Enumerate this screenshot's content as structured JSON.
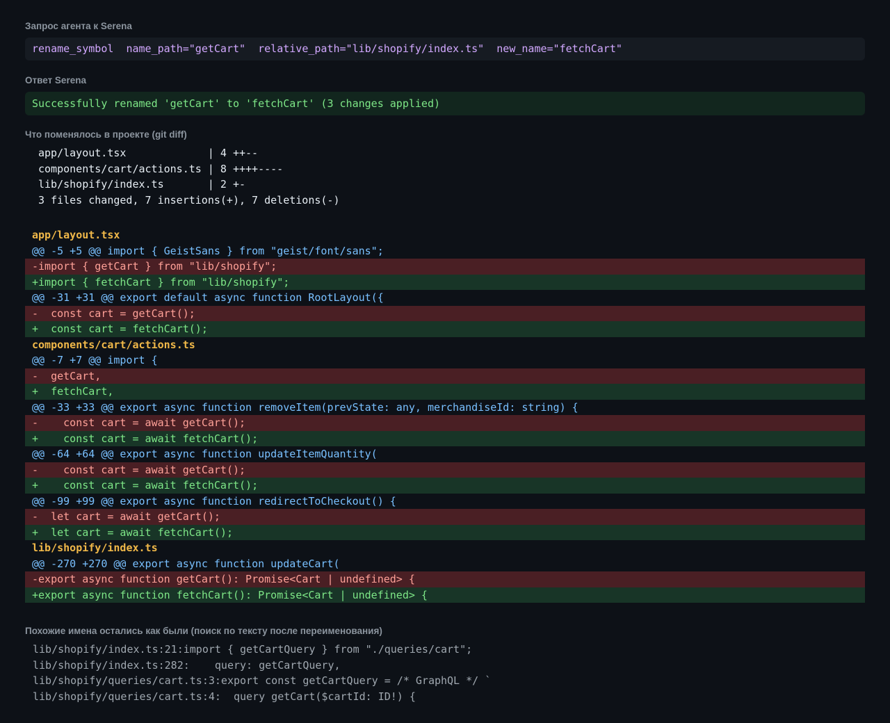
{
  "request": {
    "label": "Запрос агента к Serena",
    "command": "rename_symbol  name_path=\"getCart\"  relative_path=\"lib/shopify/index.ts\"  new_name=\"fetchCart\""
  },
  "response": {
    "label": "Ответ Serena",
    "text": "Successfully renamed 'getCart' to 'fetchCart' (3 changes applied)"
  },
  "diff": {
    "label": "Что поменялось в проекте (git diff)",
    "stat": [
      "app/layout.tsx             | 4 ++--",
      "components/cart/actions.ts | 8 ++++----",
      "lib/shopify/index.ts       | 2 +-",
      "3 files changed, 7 insertions(+), 7 deletions(-)"
    ],
    "lines": [
      {
        "type": "file",
        "text": "app/layout.tsx"
      },
      {
        "type": "hunk",
        "text": "@@ -5 +5 @@ import { GeistSans } from \"geist/font/sans\";"
      },
      {
        "type": "del",
        "text": "-import { getCart } from \"lib/shopify\";"
      },
      {
        "type": "add",
        "text": "+import { fetchCart } from \"lib/shopify\";"
      },
      {
        "type": "hunk",
        "text": "@@ -31 +31 @@ export default async function RootLayout({"
      },
      {
        "type": "del",
        "text": "-  const cart = getCart();"
      },
      {
        "type": "add",
        "text": "+  const cart = fetchCart();"
      },
      {
        "type": "file",
        "text": "components/cart/actions.ts"
      },
      {
        "type": "hunk",
        "text": "@@ -7 +7 @@ import {"
      },
      {
        "type": "del",
        "text": "-  getCart,"
      },
      {
        "type": "add",
        "text": "+  fetchCart,"
      },
      {
        "type": "hunk",
        "text": "@@ -33 +33 @@ export async function removeItem(prevState: any, merchandiseId: string) {"
      },
      {
        "type": "del",
        "text": "-    const cart = await getCart();"
      },
      {
        "type": "add",
        "text": "+    const cart = await fetchCart();"
      },
      {
        "type": "hunk",
        "text": "@@ -64 +64 @@ export async function updateItemQuantity("
      },
      {
        "type": "del",
        "text": "-    const cart = await getCart();"
      },
      {
        "type": "add",
        "text": "+    const cart = await fetchCart();"
      },
      {
        "type": "hunk",
        "text": "@@ -99 +99 @@ export async function redirectToCheckout() {"
      },
      {
        "type": "del",
        "text": "-  let cart = await getCart();"
      },
      {
        "type": "add",
        "text": "+  let cart = await fetchCart();"
      },
      {
        "type": "file",
        "text": "lib/shopify/index.ts"
      },
      {
        "type": "hunk",
        "text": "@@ -270 +270 @@ export async function updateCart("
      },
      {
        "type": "del",
        "text": "-export async function getCart(): Promise<Cart | undefined> {"
      },
      {
        "type": "add",
        "text": "+export async function fetchCart(): Promise<Cart | undefined> {"
      }
    ]
  },
  "similar": {
    "label": "Похожие имена остались как были (поиск по тексту после переименования)",
    "lines": [
      "lib/shopify/index.ts:21:import { getCartQuery } from \"./queries/cart\";",
      "lib/shopify/index.ts:282:    query: getCartQuery,",
      "lib/shopify/queries/cart.ts:3:export const getCartQuery = /* GraphQL */ `",
      "lib/shopify/queries/cart.ts:4:  query getCart($cartId: ID!) {"
    ]
  },
  "colors": {
    "background": "#0d1117",
    "deleted_line": "#ffa198",
    "added_line": "#7ee787",
    "hunk_header": "#79c0ff",
    "file_header": "#f0b849"
  }
}
